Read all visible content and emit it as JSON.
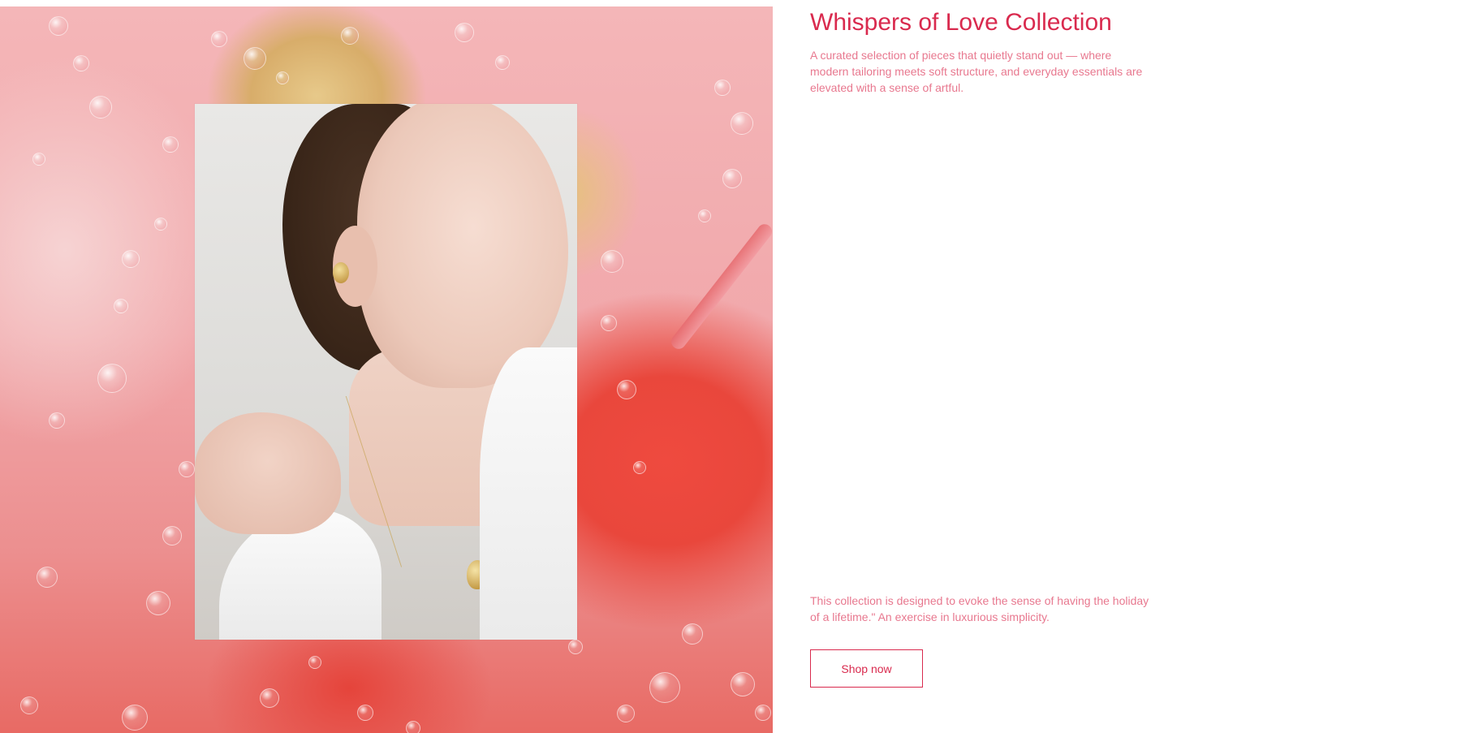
{
  "hero": {
    "image_alt": "Model wearing gold earring and pendant necklace over pink bubble background"
  },
  "collection": {
    "title": "Whispers of Love Collection",
    "intro": "A curated selection of pieces that quietly stand out — where modern tailoring meets soft structure, and everyday essentials are elevated with a sense of artful.",
    "outro": "This collection is designed to evoke the sense of having the holiday of a lifetime.\" An exercise in luxurious simplicity.",
    "cta_label": "Shop now"
  },
  "colors": {
    "accent": "#d92a4e",
    "body_text": "#e8788f",
    "background": "#ffffff"
  }
}
